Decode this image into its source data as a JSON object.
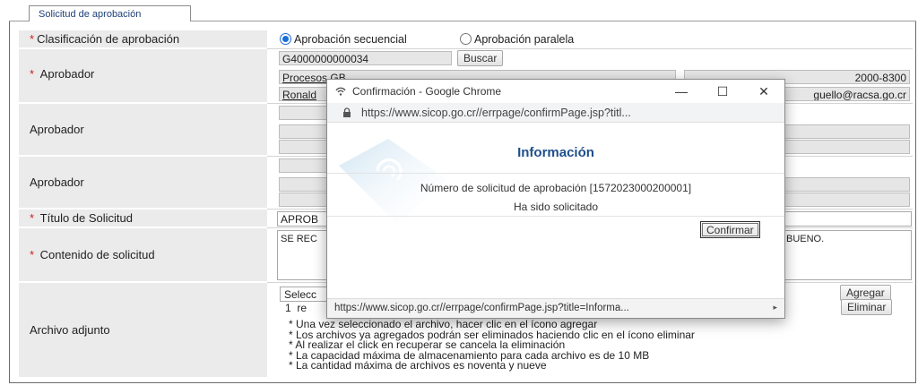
{
  "tab": {
    "label": "Solicitud de aprobación"
  },
  "form": {
    "clasificacion": {
      "label": "Clasificación de aprobación",
      "option_secuencial": "Aprobación secuencial",
      "option_paralela": "Aprobación paralela"
    },
    "aprobador1": {
      "label": "Aprobador",
      "code": "G4000000000034",
      "search_button": "Buscar",
      "org": "Procesos GB",
      "name": "Ronald",
      "phone": "2000-8300",
      "email": "guello@racsa.go.cr"
    },
    "aprobador2": {
      "label": "Aprobador"
    },
    "aprobador3": {
      "label": "Aprobador"
    },
    "titulo": {
      "label": "Título de Solicitud",
      "value": "APROB"
    },
    "contenido": {
      "label": "Contenido de solicitud",
      "value_start": "SE REC",
      "value_end": "BUENO."
    },
    "archivo": {
      "label": "Archivo adjunto",
      "select_prefix": "Selecc",
      "row_num": "1",
      "row_prefix": "re",
      "add_button": "Agregar",
      "delete_button": "Eliminar",
      "hints": [
        "* Una vez seleccionado el archivo, hacer clic en el ícono agregar",
        "* Los archivos ya agregados podrán ser eliminados haciendo clic en el ícono eliminar",
        "* Al realizar el click en recuperar se cancela la eliminación",
        "* La capacidad máxima de almacenamiento para cada archivo es de 10 MB",
        "* La cantidad máxima de archivos es noventa y nueve"
      ]
    }
  },
  "popup": {
    "window_title": "Confirmación - Google Chrome",
    "url": "https://www.sicop.go.cr//errpage/confirmPage.jsp?titl...",
    "heading": "Información",
    "message_line1": "Número de solicitud de aprobación [1572023000200001]",
    "message_line2": "Ha sido solicitado",
    "confirm_button": "Confirmar",
    "status_url": "https://www.sicop.go.cr//errpage/confirmPage.jsp?title=Informa..."
  },
  "colors": {
    "label_bg": "#ebebeb",
    "link_blue": "#1f4f8a",
    "required_red": "#cc2222",
    "radio_blue": "#1a6ed8"
  }
}
